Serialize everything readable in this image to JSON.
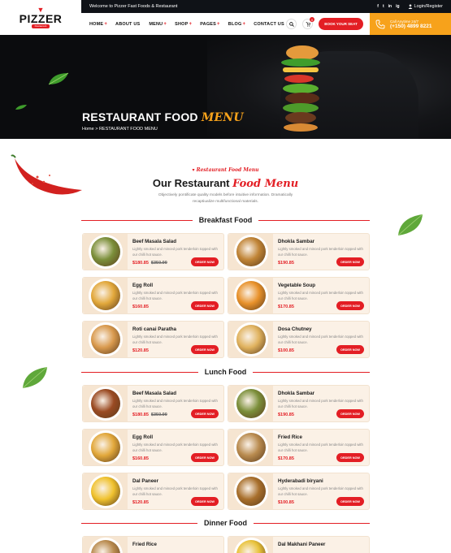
{
  "header": {
    "logo_text": "PIZZER",
    "logo_sub": "Restaurant",
    "welcome": "Welcome to Pizzer Fast Foods & Restaurant",
    "socials": [
      "f",
      "t",
      "in",
      "ig"
    ],
    "login": "Login/Register",
    "nav": [
      {
        "label": "HOME",
        "plus": "+"
      },
      {
        "label": "ABOUT US",
        "plus": ""
      },
      {
        "label": "MENU",
        "plus": "+"
      },
      {
        "label": "SHOP",
        "plus": "+"
      },
      {
        "label": "PAGES",
        "plus": "+"
      },
      {
        "label": "BLOG",
        "plus": "+"
      },
      {
        "label": "CONTACT US",
        "plus": ""
      }
    ],
    "cart_count": "0",
    "book_label": "BOOK YOUR SEAT",
    "call_label": "Call Anytime 24/7",
    "call_number": "(+150) 4899 8221"
  },
  "hero": {
    "title_main": "RESTAURANT FOOD",
    "title_accent": "MENU",
    "breadcrumb_home": "Home",
    "breadcrumb_sep": ">",
    "breadcrumb_current": "RESTAURANT FOOD MENU"
  },
  "section": {
    "tag": "Restaurant Food Menu",
    "title_main": "Our Restaurant",
    "title_accent": "Food Menu",
    "description": "Objectively pontificate quality models before intuitive information. Dramatically recaptiualize multifunctional materials."
  },
  "categories": [
    {
      "name": "Breakfast Food",
      "items": [
        {
          "title": "Beef Masala Salad",
          "desc": "Lightly smoked and minced pork tenderloin topped with our chilli hot sauce.",
          "price": "$180.85",
          "old": "$350.99",
          "button": "ORDER NOW",
          "color": "#7b8f3a"
        },
        {
          "title": "Dhokla Sambar",
          "desc": "Lightly smoked and minced pork tenderloin topped with our chilli hot sauce.",
          "price": "$190.85",
          "old": "",
          "button": "ORDER NOW",
          "color": "#c08436"
        },
        {
          "title": "Egg Roll",
          "desc": "Lightly smoked and minced pork tenderloin topped with our chilli hot sauce.",
          "price": "$160.85",
          "old": "",
          "button": "ORDER NOW",
          "color": "#e2a83b"
        },
        {
          "title": "Vegetable Soup",
          "desc": "Lightly smoked and minced pork tenderloin topped with our chilli hot sauce.",
          "price": "$170.85",
          "old": "",
          "button": "ORDER NOW",
          "color": "#e8912a"
        },
        {
          "title": "Roti canai Paratha",
          "desc": "Lightly smoked and minced pork tenderloin topped with our chilli hot sauce.",
          "price": "$120.85",
          "old": "",
          "button": "ORDER NOW",
          "color": "#d99a4e"
        },
        {
          "title": "Dosa Chutney",
          "desc": "Lightly smoked and minced pork tenderloin topped with our chilli hot sauce.",
          "price": "$100.85",
          "old": "",
          "button": "ORDER NOW",
          "color": "#e0b25e"
        }
      ]
    },
    {
      "name": "Lunch Food",
      "items": [
        {
          "title": "Beef Masala Salad",
          "desc": "Lightly smoked and minced pork tenderloin topped with our chilli hot sauce.",
          "price": "$180.85",
          "old": "$350.99",
          "button": "ORDER NOW",
          "color": "#9a4a22"
        },
        {
          "title": "Dhokla Sambar",
          "desc": "Lightly smoked and minced pork tenderloin topped with our chilli hot sauce.",
          "price": "$190.85",
          "old": "",
          "button": "ORDER NOW",
          "color": "#7b8f3a"
        },
        {
          "title": "Egg Roll",
          "desc": "Lightly smoked and minced pork tenderloin topped with our chilli hot sauce.",
          "price": "$160.85",
          "old": "",
          "button": "ORDER NOW",
          "color": "#e2a83b"
        },
        {
          "title": "Fried Rice",
          "desc": "Lightly smoked and minced pork tenderloin topped with our chilli hot sauce.",
          "price": "$170.85",
          "old": "",
          "button": "ORDER NOW",
          "color": "#b98b4f"
        },
        {
          "title": "Dal Paneer",
          "desc": "Lightly smoked and minced pork tenderloin topped with our chilli hot sauce.",
          "price": "$120.85",
          "old": "",
          "button": "ORDER NOW",
          "color": "#f0c22e"
        },
        {
          "title": "Hyderabadi biryani",
          "desc": "Lightly smoked and minced pork tenderloin topped with our chilli hot sauce.",
          "price": "$100.85",
          "old": "",
          "button": "ORDER NOW",
          "color": "#a86f2c"
        }
      ]
    },
    {
      "name": "Dinner Food",
      "items": [
        {
          "title": "Fried Rice",
          "desc": "",
          "price": "",
          "old": "",
          "button": "",
          "color": "#b98b4f"
        },
        {
          "title": "Dal Makhani Paneer",
          "desc": "",
          "price": "",
          "old": "",
          "button": "",
          "color": "#e8c23a"
        }
      ]
    }
  ]
}
